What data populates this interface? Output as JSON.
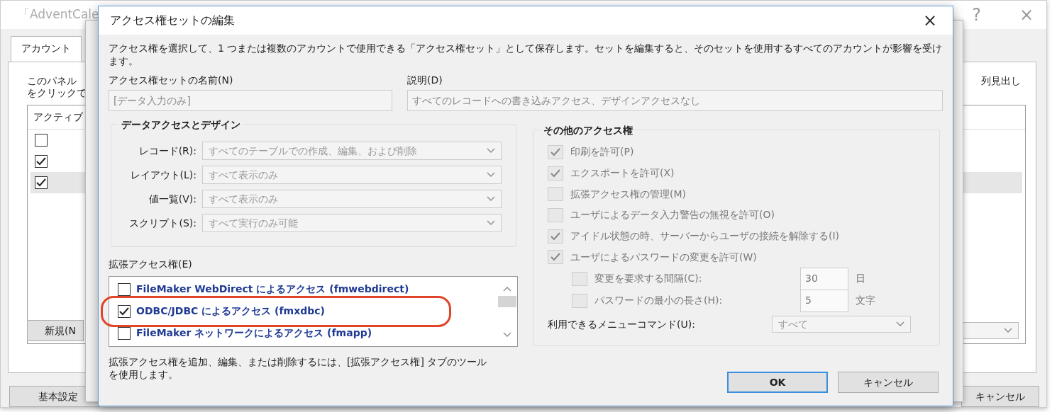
{
  "background_window": {
    "title": "「AdventCale",
    "help": "?",
    "close": "×",
    "tabs": [
      {
        "label": "アカウント",
        "selected": true
      }
    ],
    "panel_text": [
      "このパネル",
      "をクリックで"
    ],
    "right_heading": "列見出し",
    "list": {
      "column_1": "アクティブ",
      "rows": [
        {
          "active": false,
          "selected": false
        },
        {
          "active": true,
          "selected": false
        },
        {
          "active": true,
          "selected": true
        }
      ]
    },
    "new_button": "新規(N",
    "buttons": [
      "基本設定",
      "キャンセル"
    ]
  },
  "dialog": {
    "title": "アクセス権セットの編集",
    "close": "×",
    "description": "アクセス権を選択して、1 つまたは複数のアカウントで使用できる「アクセス権セット」として保存します。セットを編集すると、そのセットを使用するすべてのアカウントが影響を受けます。",
    "name_field": {
      "label": "アクセス権セットの名前(N)",
      "value": "[データ入力のみ]"
    },
    "description_field": {
      "label": "説明(D)",
      "value": "すべてのレコードへの書き込みアクセス、デザインアクセスなし"
    },
    "data_access": {
      "title": "データアクセスとデザイン",
      "disabled": true,
      "rows": [
        {
          "label": "レコード(R):",
          "value": "すべてのテーブルでの作成、編集、および削除"
        },
        {
          "label": "レイアウト(L):",
          "value": "すべて表示のみ"
        },
        {
          "label": "値一覧(V):",
          "value": "すべて表示のみ"
        },
        {
          "label": "スクリプト(S):",
          "value": "すべて実行のみ可能"
        }
      ]
    },
    "extended": {
      "label": "拡張アクセス権(E)",
      "items": [
        {
          "text": "FileMaker WebDirect によるアクセス (fmwebdirect)",
          "checked": false,
          "highlighted": false
        },
        {
          "text": "ODBC/JDBC によるアクセス (fmxdbc)",
          "checked": true,
          "highlighted": true
        },
        {
          "text": "FileMaker ネットワークによるアクセス (fmapp)",
          "checked": false,
          "highlighted": false
        }
      ],
      "note": "拡張アクセス権を追加、編集、または削除するには、[拡張アクセス権] タブのツールを使用します。"
    },
    "other": {
      "title": "その他のアクセス権",
      "disabled": true,
      "options": [
        {
          "label": "印刷を許可(P)",
          "checked": true
        },
        {
          "label": "エクスポートを許可(X)",
          "checked": true
        },
        {
          "label": "拡張アクセス権の管理(M)",
          "checked": false
        },
        {
          "label": "ユーザによるデータ入力警告の無視を許可(O)",
          "checked": false
        },
        {
          "label": "アイドル状態の時、サーバーからユーザの接続を解除する(I)",
          "checked": true
        },
        {
          "label": "ユーザによるパスワードの変更を許可(W)",
          "checked": true
        }
      ],
      "sub_options": [
        {
          "label": "変更を要求する間隔(C):",
          "checked": false,
          "value": "30",
          "unit": "日"
        },
        {
          "label": "パスワードの最小の長さ(H):",
          "checked": false,
          "value": "5",
          "unit": "文字"
        }
      ],
      "menu": {
        "label": "利用できるメニューコマンド(U):",
        "value": "すべて"
      }
    },
    "buttons": [
      {
        "label": "OK",
        "default": true
      },
      {
        "label": "キャンセル",
        "default": false
      }
    ]
  }
}
